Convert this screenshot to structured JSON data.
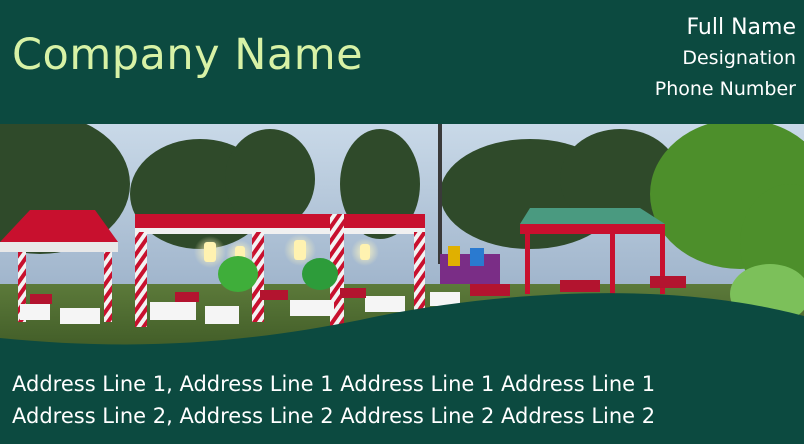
{
  "card": {
    "company_name": "Company Name",
    "full_name": "Full Name",
    "designation": "Designation",
    "phone": "Phone Number",
    "address_line_1": "Address Line 1,  Address Line 1 Address Line 1 Address Line 1",
    "address_line_2": "Address Line 2,  Address Line 2 Address Line 2 Address Line 2"
  },
  "colors": {
    "background": "#0c4a40",
    "company_text": "#d8f2a6",
    "text": "#ffffff"
  },
  "image": {
    "subject": "outdoor event venue with decorated tents and tables at dusk"
  }
}
